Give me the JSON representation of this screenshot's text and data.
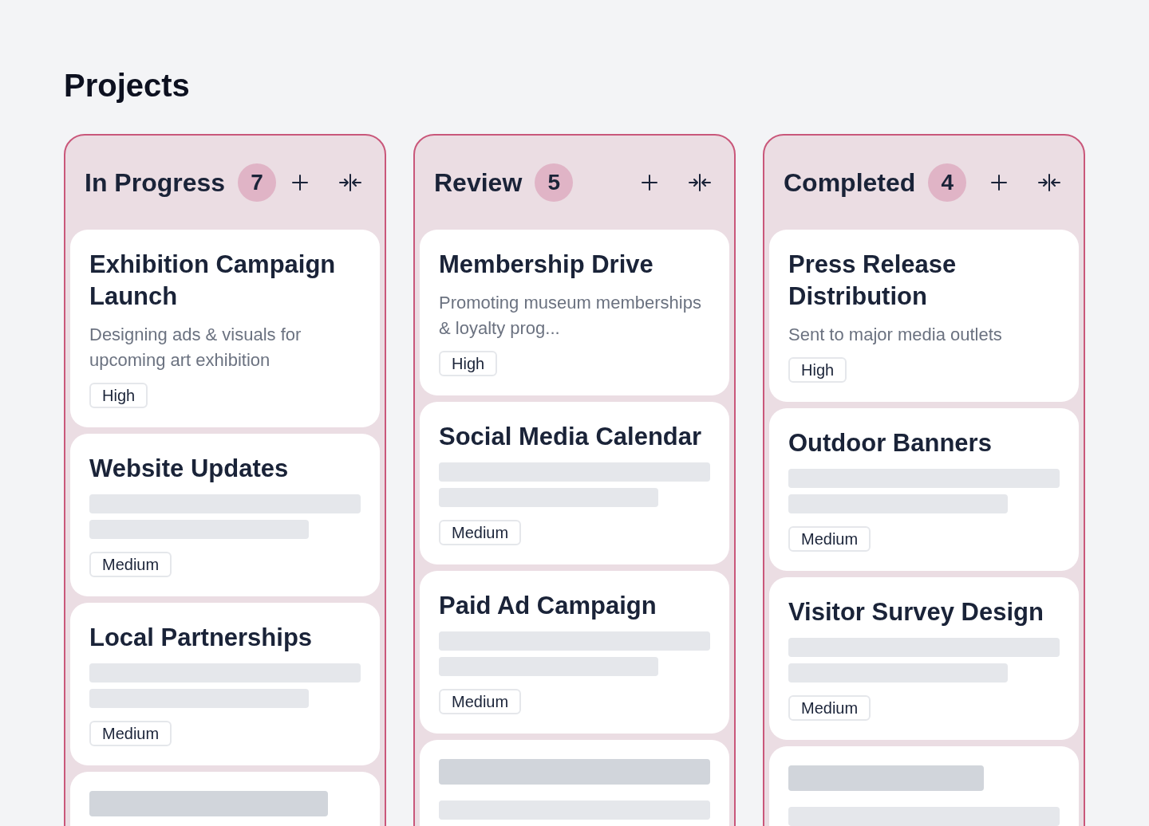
{
  "page": {
    "title": "Projects"
  },
  "columns": [
    {
      "title": "In Progress",
      "count": "7",
      "cards": [
        {
          "kind": "full",
          "title": "Exhibition Campaign Launch",
          "description": "Designing ads & visuals for upcoming art exhibition",
          "priority": "High"
        },
        {
          "kind": "skeleton",
          "title": "Website Updates",
          "priority": "Medium"
        },
        {
          "kind": "skeleton",
          "title": "Local Partnerships",
          "priority": "Medium"
        },
        {
          "kind": "loading",
          "bars": [
            {
              "kind": "heading"
            }
          ]
        }
      ]
    },
    {
      "title": "Review",
      "count": "5",
      "cards": [
        {
          "kind": "full",
          "title": "Membership Drive",
          "description": "Promoting museum memberships & loyalty prog...",
          "priority": "High"
        },
        {
          "kind": "skeleton",
          "title": "Social Media Calendar",
          "priority": "Medium"
        },
        {
          "kind": "skeleton",
          "title": "Paid Ad Campaign",
          "priority": "Medium"
        },
        {
          "kind": "loading",
          "bars": [
            {
              "kind": "heading"
            },
            {
              "kind": "line"
            }
          ]
        }
      ]
    },
    {
      "title": "Completed",
      "count": "4",
      "cards": [
        {
          "kind": "full",
          "title": "Press Release Distribution",
          "description": "Sent to major media outlets",
          "priority": "High"
        },
        {
          "kind": "skeleton",
          "title": "Outdoor Banners",
          "priority": "Medium"
        },
        {
          "kind": "skeleton",
          "title": "Visitor Survey Design",
          "priority": "Medium"
        },
        {
          "kind": "loading",
          "bars": [
            {
              "kind": "heading"
            },
            {
              "kind": "line"
            }
          ]
        }
      ]
    }
  ]
}
